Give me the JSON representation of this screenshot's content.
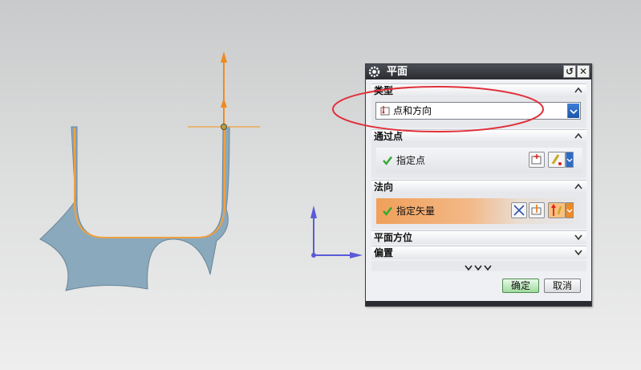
{
  "dialog": {
    "title": "平面",
    "sections": {
      "type": {
        "label": "类型",
        "selected": "点和方向"
      },
      "through_point": {
        "label": "通过点",
        "row_label": "指定点"
      },
      "normal": {
        "label": "法向",
        "row_label": "指定矢量"
      },
      "orientation": {
        "label": "平面方位"
      },
      "offset": {
        "label": "偏置"
      }
    },
    "buttons": {
      "ok": "确定",
      "cancel": "取消"
    }
  },
  "icons": {
    "dialog": "gear-icon",
    "reset": "reset-icon",
    "close": "close-icon",
    "collapse": "chevron-up-icon",
    "expand": "chevron-down-icon",
    "more": "triple-chevron-down-icon",
    "status": "check-icon",
    "vector": "vector-icon"
  },
  "colors": {
    "highlight_row": "#f0a05a",
    "check_green": "#2faa2f",
    "annotation_red": "#e0303a",
    "part_fill": "#8aa9bc",
    "part_edge": "#f0a040",
    "axis_blue": "#5a5ad8",
    "axis_orange": "#f08a20"
  }
}
